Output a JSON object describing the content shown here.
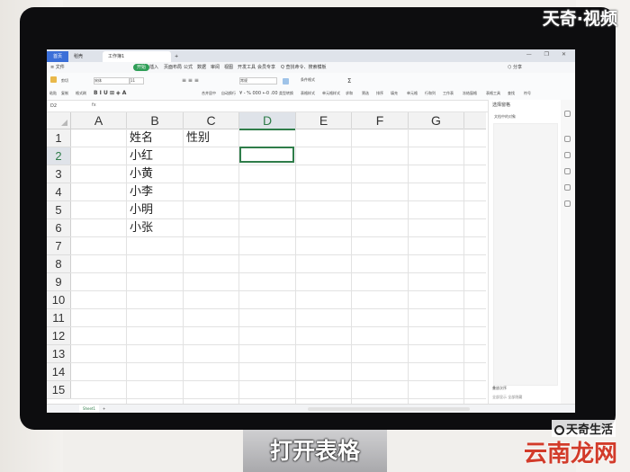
{
  "titlebar": {
    "home_tab": "首页",
    "doc_tab": "稻壳",
    "sheet_tab": "工作簿1",
    "plus": "+",
    "window_controls": "— ❐ ✕"
  },
  "menu": {
    "file": "≡ 文件",
    "items": [
      "开始",
      "插入",
      "页面布局",
      "公式",
      "数据",
      "审阅",
      "视图",
      "开发工具",
      "会员专享"
    ],
    "search": "Q 查找命令、搜索模板",
    "right": "⬡ 分享"
  },
  "toolbar": {
    "paste": "粘贴",
    "cut": "剪切",
    "copy": "复制",
    "format_painter": "格式刷",
    "font": "宋体",
    "font_size": "11",
    "merge_center": "合并居中",
    "wrap": "自动换行",
    "number_format": "常规",
    "cond_format": "条件格式",
    "table_style": "表格样式",
    "cell_style": "单元格样式",
    "sum": "求和",
    "filter": "筛选",
    "sort": "排序",
    "fill": "填充",
    "cell": "单元格",
    "row_col": "行和列",
    "worksheet": "工作表",
    "freeze": "冻结窗格",
    "table_tools": "表格工具",
    "find": "查找",
    "symbol": "符号"
  },
  "formula_bar": {
    "name_box": "D2",
    "fx": "fx"
  },
  "columns": [
    "A",
    "B",
    "C",
    "D",
    "E",
    "F",
    "G"
  ],
  "selected_column": "D",
  "rows": [
    "1",
    "2",
    "3",
    "4",
    "5",
    "6",
    "7",
    "8",
    "9",
    "10",
    "11",
    "12",
    "13",
    "14",
    "15"
  ],
  "selected_row": "2",
  "cells": {
    "B1": "姓名",
    "C1": "性别",
    "B2": "小红",
    "B3": "小黄",
    "B4": "小李",
    "B5": "小明",
    "B6": "小张"
  },
  "panel": {
    "title": "选择窗格",
    "subtitle": "文档中的对象",
    "footer": "叠放次序",
    "footer2": "全部显示   全部隐藏"
  },
  "sheetbar": {
    "sheet_name": "Sheet1",
    "add": "+"
  },
  "caption": "打开表格",
  "watermark_top": "天奇·视频",
  "watermark_bottom1": "天奇生活",
  "watermark_bottom2": "云南龙网"
}
